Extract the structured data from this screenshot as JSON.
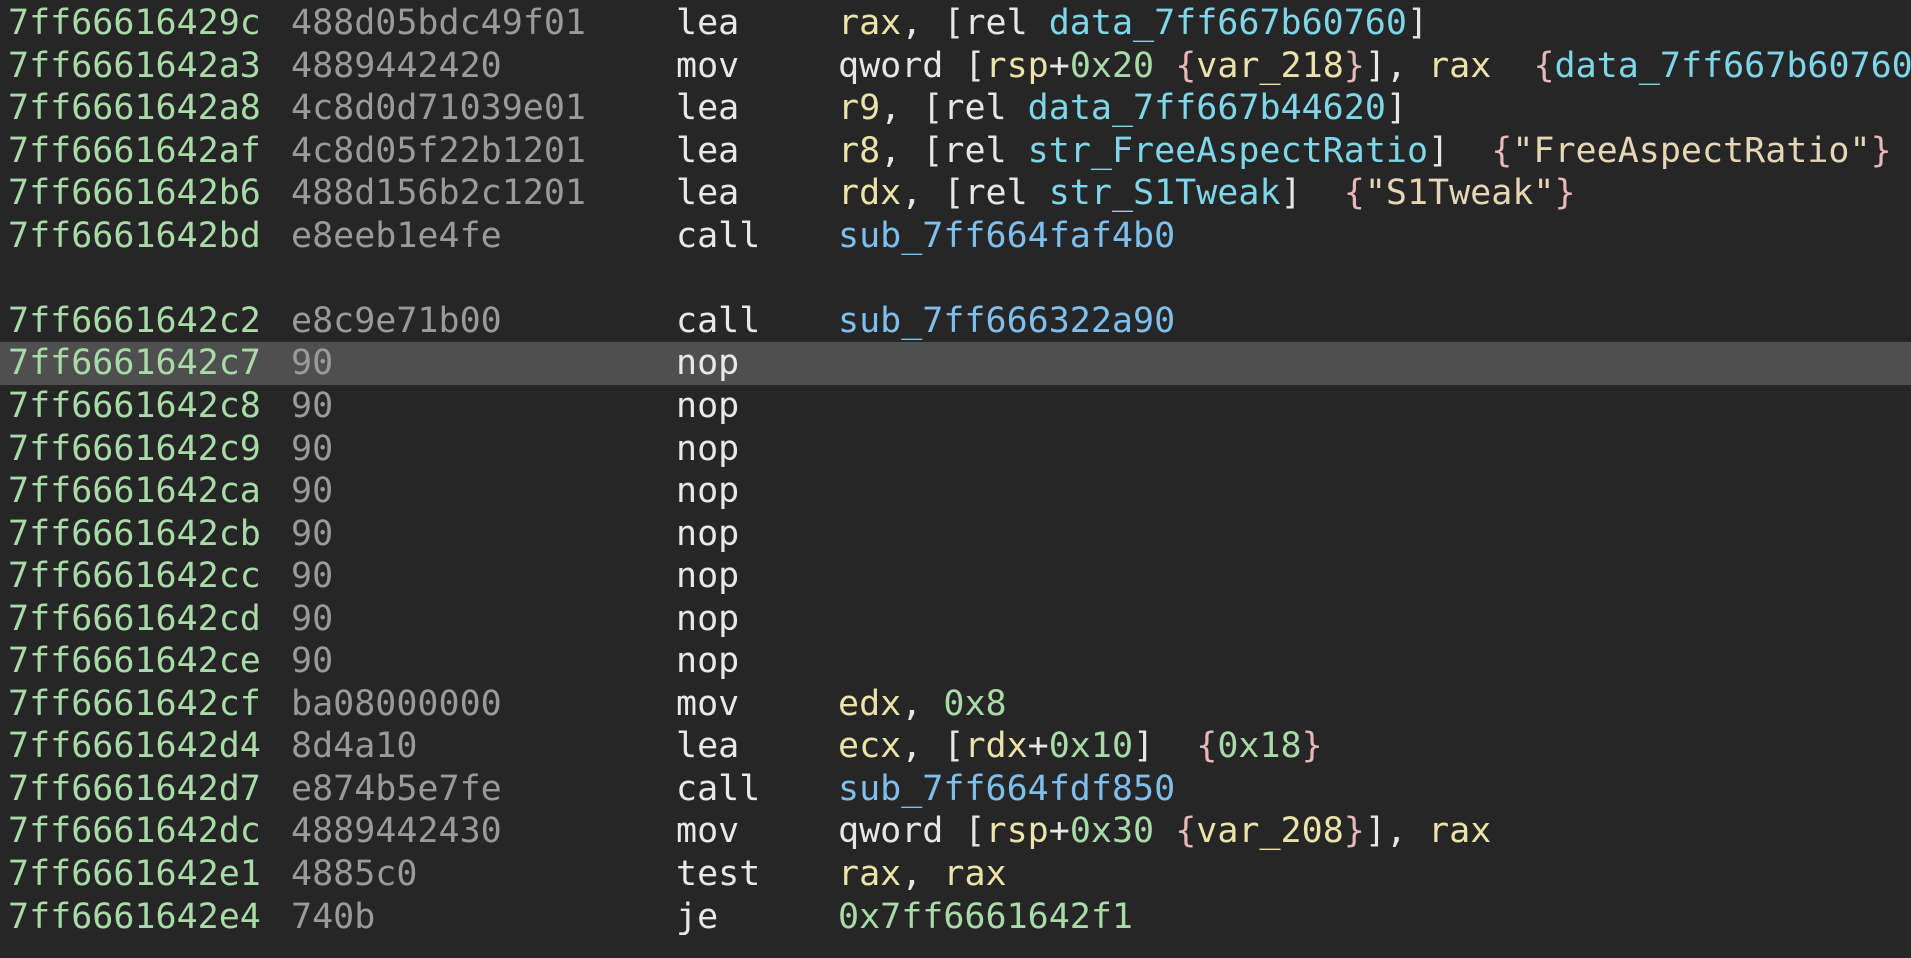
{
  "colors": {
    "background": "#262626",
    "selected_row": "#4f4f4f",
    "address": "#a8dba8",
    "bytes": "#9a9a9a",
    "register": "#ece3a8",
    "number": "#a8dba8",
    "data_symbol": "#7fd6e8",
    "sub_symbol": "#7fbfee",
    "string": "#e6d6b6",
    "brace": "#e8b8b8"
  },
  "rows": [
    {
      "addr": "7ff66616429c",
      "bytes": "488d05bdc49f01",
      "mnemonic": "lea",
      "ops": [
        [
          "reg",
          "rax"
        ],
        [
          "plain",
          ", ["
        ],
        [
          "plain",
          "rel "
        ],
        [
          "sym",
          "data_7ff667b60760"
        ],
        [
          "plain",
          "]"
        ]
      ]
    },
    {
      "addr": "7ff6661642a3",
      "bytes": "4889442420",
      "mnemonic": "mov",
      "ops": [
        [
          "plain",
          "qword ["
        ],
        [
          "reg",
          "rsp"
        ],
        [
          "plain",
          "+"
        ],
        [
          "num",
          "0x20"
        ],
        [
          "plain",
          " "
        ],
        [
          "br",
          "{"
        ],
        [
          "var",
          "var_218"
        ],
        [
          "br",
          "}"
        ],
        [
          "plain",
          "], "
        ],
        [
          "reg",
          "rax"
        ],
        [
          "plain",
          "  "
        ],
        [
          "br",
          "{"
        ],
        [
          "sym",
          "data_7ff667b60760"
        ],
        [
          "br",
          "}"
        ]
      ]
    },
    {
      "addr": "7ff6661642a8",
      "bytes": "4c8d0d71039e01",
      "mnemonic": "lea",
      "ops": [
        [
          "reg",
          "r9"
        ],
        [
          "plain",
          ", ["
        ],
        [
          "plain",
          "rel "
        ],
        [
          "sym",
          "data_7ff667b44620"
        ],
        [
          "plain",
          "]"
        ]
      ]
    },
    {
      "addr": "7ff6661642af",
      "bytes": "4c8d05f22b1201",
      "mnemonic": "lea",
      "ops": [
        [
          "reg",
          "r8"
        ],
        [
          "plain",
          ", ["
        ],
        [
          "plain",
          "rel "
        ],
        [
          "sym",
          "str_FreeAspectRatio"
        ],
        [
          "plain",
          "]  "
        ],
        [
          "br",
          "{"
        ],
        [
          "str",
          "\"FreeAspectRatio\""
        ],
        [
          "br",
          "}"
        ]
      ]
    },
    {
      "addr": "7ff6661642b6",
      "bytes": "488d156b2c1201",
      "mnemonic": "lea",
      "ops": [
        [
          "reg",
          "rdx"
        ],
        [
          "plain",
          ", ["
        ],
        [
          "plain",
          "rel "
        ],
        [
          "sym",
          "str_S1Tweak"
        ],
        [
          "plain",
          "]  "
        ],
        [
          "br",
          "{"
        ],
        [
          "str",
          "\"S1Tweak\""
        ],
        [
          "br",
          "}"
        ]
      ]
    },
    {
      "addr": "7ff6661642bd",
      "bytes": "e8eeb1e4fe",
      "mnemonic": "call",
      "ops": [
        [
          "sub",
          "sub_7ff664faf4b0"
        ]
      ]
    },
    {
      "blank": true
    },
    {
      "addr": "7ff6661642c2",
      "bytes": "e8c9e71b00",
      "mnemonic": "call",
      "ops": [
        [
          "sub",
          "sub_7ff666322a90"
        ]
      ]
    },
    {
      "addr": "7ff6661642c7",
      "bytes": "90",
      "mnemonic": "nop",
      "ops": [],
      "selected": true
    },
    {
      "addr": "7ff6661642c8",
      "bytes": "90",
      "mnemonic": "nop",
      "ops": []
    },
    {
      "addr": "7ff6661642c9",
      "bytes": "90",
      "mnemonic": "nop",
      "ops": []
    },
    {
      "addr": "7ff6661642ca",
      "bytes": "90",
      "mnemonic": "nop",
      "ops": []
    },
    {
      "addr": "7ff6661642cb",
      "bytes": "90",
      "mnemonic": "nop",
      "ops": []
    },
    {
      "addr": "7ff6661642cc",
      "bytes": "90",
      "mnemonic": "nop",
      "ops": []
    },
    {
      "addr": "7ff6661642cd",
      "bytes": "90",
      "mnemonic": "nop",
      "ops": []
    },
    {
      "addr": "7ff6661642ce",
      "bytes": "90",
      "mnemonic": "nop",
      "ops": []
    },
    {
      "addr": "7ff6661642cf",
      "bytes": "ba08000000",
      "mnemonic": "mov",
      "ops": [
        [
          "reg",
          "edx"
        ],
        [
          "plain",
          ", "
        ],
        [
          "num",
          "0x8"
        ]
      ]
    },
    {
      "addr": "7ff6661642d4",
      "bytes": "8d4a10",
      "mnemonic": "lea",
      "ops": [
        [
          "reg",
          "ecx"
        ],
        [
          "plain",
          ", ["
        ],
        [
          "reg",
          "rdx"
        ],
        [
          "plain",
          "+"
        ],
        [
          "num",
          "0x10"
        ],
        [
          "plain",
          "]  "
        ],
        [
          "br",
          "{"
        ],
        [
          "num",
          "0x18"
        ],
        [
          "br",
          "}"
        ]
      ]
    },
    {
      "addr": "7ff6661642d7",
      "bytes": "e874b5e7fe",
      "mnemonic": "call",
      "ops": [
        [
          "sub",
          "sub_7ff664fdf850"
        ]
      ]
    },
    {
      "addr": "7ff6661642dc",
      "bytes": "4889442430",
      "mnemonic": "mov",
      "ops": [
        [
          "plain",
          "qword ["
        ],
        [
          "reg",
          "rsp"
        ],
        [
          "plain",
          "+"
        ],
        [
          "num",
          "0x30"
        ],
        [
          "plain",
          " "
        ],
        [
          "br",
          "{"
        ],
        [
          "var",
          "var_208"
        ],
        [
          "br",
          "}"
        ],
        [
          "plain",
          "], "
        ],
        [
          "reg",
          "rax"
        ]
      ]
    },
    {
      "addr": "7ff6661642e1",
      "bytes": "4885c0",
      "mnemonic": "test",
      "ops": [
        [
          "reg",
          "rax"
        ],
        [
          "plain",
          ", "
        ],
        [
          "reg",
          "rax"
        ]
      ]
    },
    {
      "addr": "7ff6661642e4",
      "bytes": "740b",
      "mnemonic": "je",
      "ops": [
        [
          "num",
          "0x7ff6661642f1"
        ]
      ]
    }
  ]
}
